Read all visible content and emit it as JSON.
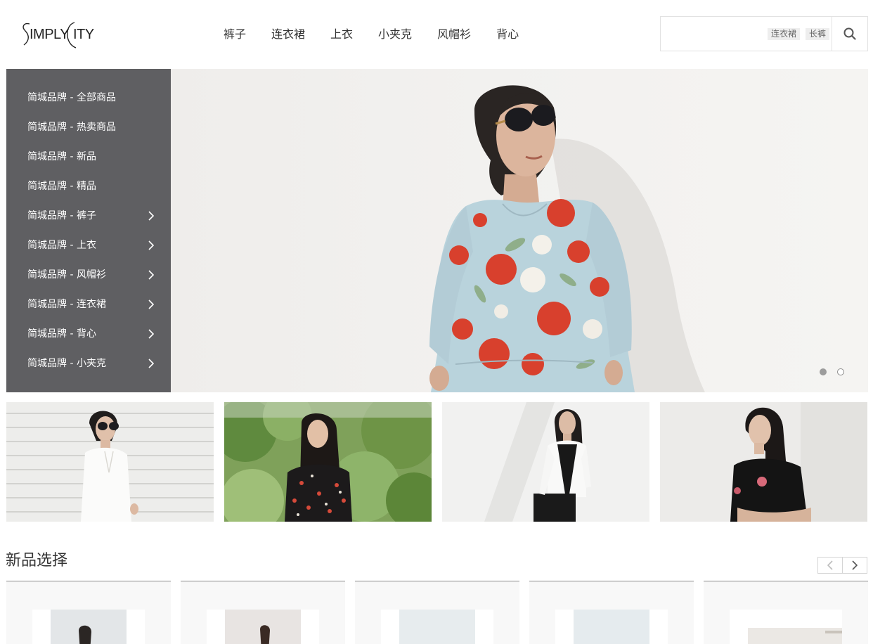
{
  "header": {
    "logo_text": "SIMPLY CITY",
    "nav": [
      "裤子",
      "连衣裙",
      "上衣",
      "小夹克",
      "风帽衫",
      "背心"
    ],
    "search": {
      "placeholder": "",
      "hot_words": [
        "连衣裙",
        "长裤"
      ],
      "button_icon": "search-icon"
    }
  },
  "side_menu": {
    "items": [
      {
        "label": "简城品牌 - 全部商品",
        "has_submenu": false
      },
      {
        "label": "简城品牌 - 热卖商品",
        "has_submenu": false
      },
      {
        "label": "简城品牌 - 新品",
        "has_submenu": false
      },
      {
        "label": "简城品牌 - 精品",
        "has_submenu": false
      },
      {
        "label": "简城品牌 - 裤子",
        "has_submenu": true
      },
      {
        "label": "简城品牌 - 上衣",
        "has_submenu": true
      },
      {
        "label": "简城品牌 - 风帽衫",
        "has_submenu": true
      },
      {
        "label": "简城品牌 - 连衣裙",
        "has_submenu": true
      },
      {
        "label": "简城品牌 - 背心",
        "has_submenu": true
      },
      {
        "label": "简城品牌 - 小夹克",
        "has_submenu": true
      }
    ],
    "arrow_icon": "chevron-right-icon"
  },
  "hero": {
    "slide_count": 2,
    "active_slide": 1,
    "image": "woman in sunglasses wearing a pale blue floral dress"
  },
  "promo_tiles": [
    {
      "image": "woman in white blazer against striped wall"
    },
    {
      "image": "woman in black floral blouse in garden"
    },
    {
      "image": "woman in white jacket over black dress"
    },
    {
      "image": "woman in black embroidered tee"
    }
  ],
  "new_arrivals": {
    "title": "新品选择",
    "prev_icon": "chevron-left-icon",
    "next_icon": "chevron-right-icon",
    "products": [
      {
        "image": "model in light outfit"
      },
      {
        "image": "model outdoors"
      },
      {
        "image": "model in pale top"
      },
      {
        "image": "model in light blue"
      },
      {
        "image": "product with brand label"
      }
    ]
  },
  "colors": {
    "side_menu_bg": "#5f5f62",
    "text": "#333333",
    "hot_word_bg": "#eeeeee",
    "dress_base": "#b9d3dc",
    "flower_red": "#d8402d"
  }
}
